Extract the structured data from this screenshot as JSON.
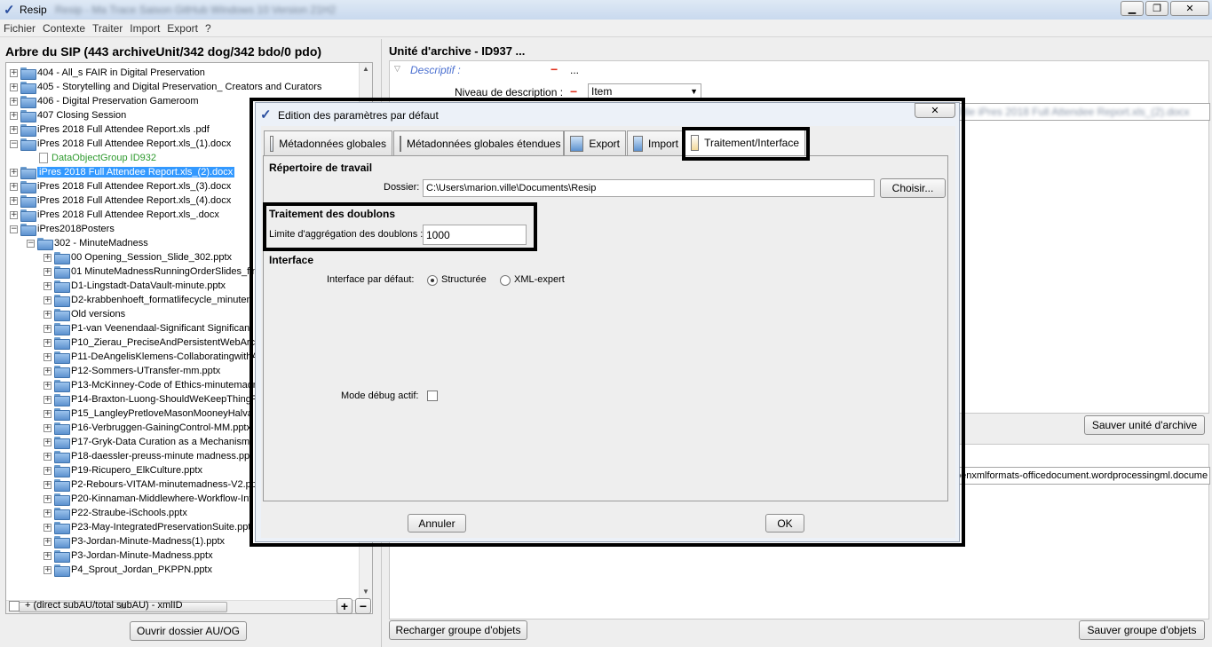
{
  "window": {
    "title": "Resip",
    "title_obscured": "Resip - Ma Trace Saison GitHub Windows 10 Version 21H2"
  },
  "menu": [
    "Fichier",
    "Contexte",
    "Traiter",
    "Import",
    "Export",
    "?"
  ],
  "left_panel": {
    "title": "Arbre du SIP (443 archiveUnit/342 dog/342 bdo/0 pdo)",
    "tree": [
      {
        "label": "404 - All_s FAIR in Digital Preservation",
        "level": 0,
        "type": "folder"
      },
      {
        "label": "405 - Storytelling and Digital Preservation_ Creators and Curators",
        "level": 0,
        "type": "folder"
      },
      {
        "label": "406 - Digital Preservation Gameroom",
        "level": 0,
        "type": "folder"
      },
      {
        "label": "407 Closing Session",
        "level": 0,
        "type": "folder"
      },
      {
        "label": "iPres 2018 Full Attendee Report.xls .pdf",
        "level": 0,
        "type": "folder"
      },
      {
        "label": "iPres 2018 Full Attendee Report.xls_(1).docx",
        "level": 0,
        "type": "folder",
        "expanded": true
      },
      {
        "label": "DataObjectGroup ID932",
        "level": 1,
        "type": "dog"
      },
      {
        "label": "iPres 2018 Full Attendee Report.xls_(2).docx",
        "level": 0,
        "type": "folder",
        "selected": true
      },
      {
        "label": "iPres 2018 Full Attendee Report.xls_(3).docx",
        "level": 0,
        "type": "folder"
      },
      {
        "label": "iPres 2018 Full Attendee Report.xls_(4).docx",
        "level": 0,
        "type": "folder"
      },
      {
        "label": "iPres 2018 Full Attendee Report.xls_.docx",
        "level": 0,
        "type": "folder"
      },
      {
        "label": "iPres2018Posters",
        "level": 0,
        "type": "folder",
        "expanded": true
      },
      {
        "label": "302 - MinuteMadness",
        "level": 1,
        "type": "folder",
        "expanded": true
      },
      {
        "label": "00 Opening_Session_Slide_302.pptx",
        "level": 2,
        "type": "folder"
      },
      {
        "label": "01 MinuteMadnessRunningOrderSlides_fin",
        "level": 2,
        "type": "folder"
      },
      {
        "label": "D1-Lingstadt-DataVault-minute.pptx",
        "level": 2,
        "type": "folder"
      },
      {
        "label": "D2-krabbenhoeft_formatlifecycle_minuten",
        "level": 2,
        "type": "folder"
      },
      {
        "label": "Old versions",
        "level": 2,
        "type": "folder"
      },
      {
        "label": "P1-van Veenendaal-Significant Significant",
        "level": 2,
        "type": "folder"
      },
      {
        "label": "P10_Zierau_PreciseAndPersistentWebArc",
        "level": 2,
        "type": "folder"
      },
      {
        "label": "P11-DeAngelisKlemens-CollaboratingwithA",
        "level": 2,
        "type": "folder"
      },
      {
        "label": "P12-Sommers-UTransfer-mm.pptx",
        "level": 2,
        "type": "folder"
      },
      {
        "label": "P13-McKinney-Code of Ethics-minutemadn",
        "level": 2,
        "type": "folder"
      },
      {
        "label": "P14-Braxton-Luong-ShouldWeKeepThingP",
        "level": 2,
        "type": "folder"
      },
      {
        "label": "P15_LangleyPretloveMasonMooneyHalva",
        "level": 2,
        "type": "folder"
      },
      {
        "label": "P16-Verbruggen-GainingControl-MM.pptx",
        "level": 2,
        "type": "folder"
      },
      {
        "label": "P17-Gryk-Data Curation as a Mechanism.",
        "level": 2,
        "type": "folder"
      },
      {
        "label": "P18-daessler-preuss-minute madness.ppt",
        "level": 2,
        "type": "folder"
      },
      {
        "label": "P19-Ricupero_ElkCulture.pptx",
        "level": 2,
        "type": "folder"
      },
      {
        "label": "P2-Rebours-VITAM-minutemadness-V2.ppt",
        "level": 2,
        "type": "folder"
      },
      {
        "label": "P20-Kinnaman-Middlewhere-Workflow-Inf",
        "level": 2,
        "type": "folder"
      },
      {
        "label": "P22-Straube-iSchools.pptx",
        "level": 2,
        "type": "folder"
      },
      {
        "label": "P23-May-IntegratedPreservationSuite.ppt",
        "level": 2,
        "type": "folder"
      },
      {
        "label": "P3-Jordan-Minute-Madness(1).pptx",
        "level": 2,
        "type": "folder"
      },
      {
        "label": "P3-Jordan-Minute-Madness.pptx",
        "level": 2,
        "type": "folder"
      },
      {
        "label": "P4_Sprout_Jordan_PKPPN.pptx",
        "level": 2,
        "type": "folder"
      }
    ],
    "checkbox_label": "+ (direct subAU/total subAU) - xmlID",
    "open_button": "Ouvrir dossier AU/OG",
    "hscroll_grip": "III"
  },
  "right_panel": {
    "title": "Unité d'archive - ID937",
    "title_ellipsis": "...",
    "descriptif_label": "Descriptif :",
    "minus": "−",
    "ellipsis": "...",
    "niveau_label": "Niveau de description :",
    "niveau_value": "Item",
    "title_field_value": "Title  iPres 2018 Full Attendee Report.xls_(2).docx",
    "save_au_button": "Sauver unité d'archive",
    "format_value": "penxmlformats-officedocument.wordprocessingml.docume",
    "reload_button": "Recharger groupe d'objets",
    "save_group_button": "Sauver groupe d'objets"
  },
  "dialog": {
    "title": "Edition des paramètres par défaut",
    "tabs": [
      "Métadonnées globales",
      "Métadonnées globales étendues",
      "Export",
      "Import",
      "Traitement/Interface"
    ],
    "active_tab": 4,
    "workdir_section": "Répertoire de travail",
    "folder_label": "Dossier:",
    "folder_value": "C:\\Users\\marion.ville\\Documents\\Resip",
    "choose_button": "Choisir...",
    "dup_section": "Traitement des doublons",
    "dup_label": "Limite d'aggrégation des doublons :",
    "dup_value": "1000",
    "interface_section": "Interface",
    "interface_label": "Interface par défaut:",
    "radio_structured": "Structurée",
    "radio_xml": "XML-expert",
    "debug_label": "Mode débug actif:",
    "cancel_button": "Annuler",
    "ok_button": "OK",
    "close_glyph": "✕"
  }
}
